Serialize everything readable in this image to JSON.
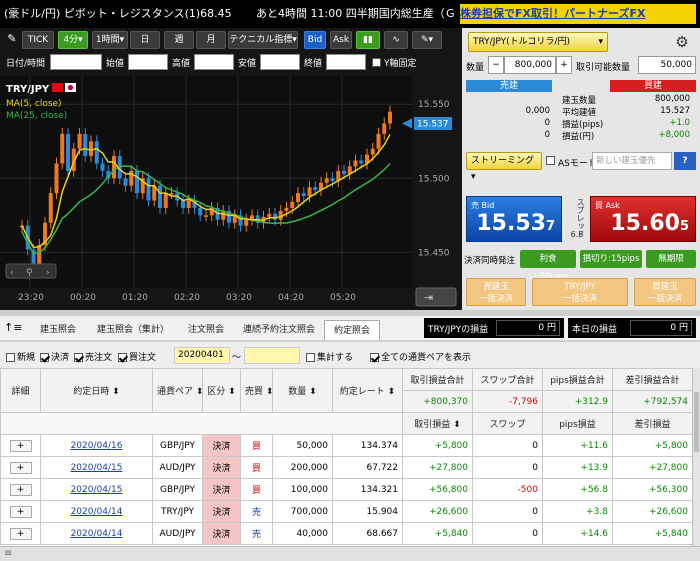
{
  "ticker": {
    "item1": "(豪ドル/円) ピボット・レジスタンス(1)68.45",
    "item2": "あと4時間 11:00 四半期国内総生産（ＧＤＰ）",
    "item3": "株券担保でFX取引！パートナーズFX"
  },
  "toolbar": {
    "tick": "TICK",
    "period": "4分",
    "hour": "1時間",
    "day": "日",
    "week": "週",
    "month": "月",
    "tech": "テクニカル指標",
    "bid": "Bid",
    "ask": "Ask"
  },
  "range": {
    "start": "日付/時間",
    "open": "始値",
    "high": "高値",
    "low": "安値",
    "close": "終値",
    "yfix": "Y軸固定"
  },
  "chart": {
    "symbol": "TRY/JPY",
    "ma5": "MA(5, close)",
    "ma25": "MA(25, close)",
    "current": "15.537",
    "yticks": [
      "15.550",
      "15.500",
      "15.450"
    ],
    "xticks": [
      "23:20",
      "00:20",
      "01:20",
      "02:20",
      "03:20",
      "04:20",
      "05:20"
    ],
    "colors": {
      "up": "#f07a1a",
      "down": "#2a8ad8",
      "ma5": "#e6d020",
      "ma25": "#3ab54a"
    }
  },
  "order": {
    "pair": "TRY/JPY(トルコリラ/円)",
    "qty_label": "数量",
    "qty": "800,000",
    "available_label": "取引可能数量",
    "available": "50,000",
    "sell_head": "売建",
    "buy_head": "買建",
    "rows": [
      {
        "label": "建玉数量",
        "sell": "",
        "buy": "800,000"
      },
      {
        "label": "平均建値",
        "sell": "0.000",
        "buy": "15.527"
      },
      {
        "label": "損益(pips)",
        "sell": "0",
        "buy": "+1.0"
      },
      {
        "label": "損益(円)",
        "sell": "0",
        "buy": "+8,000"
      }
    ],
    "streaming": "ストリーミング",
    "asmode": "ASモード",
    "newposition": "新しい建玉優先",
    "help": "?",
    "bid_label": "売 Bid",
    "bid_big": "15.53",
    "bid_small": "7",
    "spread_label": "スプレッド",
    "spread": "6.8",
    "ask_label": "買 Ask",
    "ask_big": "15.60",
    "ask_small": "5",
    "simul_label": "決済同時発注",
    "take_profit": "利食い:50pips",
    "stop_loss": "損切り:15pips",
    "unlimited": "無期限",
    "close_sell": "売建玉\n一括決済",
    "close_pair": "TRY/JPY\n一括決済",
    "close_buy": "買建玉\n一括決済"
  },
  "tabs": [
    "建玉照会",
    "建玉照会（集計）",
    "注文照会",
    "連続予約注文照会",
    "約定照会"
  ],
  "pl": {
    "pair_label": "TRY/JPYの損益",
    "pair_value": "0 円",
    "today_label": "本日の損益",
    "today_value": "0 円"
  },
  "filters": {
    "new": "新規",
    "settle": "決済",
    "sell": "売注文",
    "buy": "買注文",
    "date": "20200401",
    "tilde": "～",
    "aggregate": "集計する",
    "allpairs": "全ての通貨ペアを表示"
  },
  "table": {
    "headers": [
      "詳細",
      "約定日時",
      "通貨ペア",
      "区分",
      "売買",
      "数量",
      "約定レート",
      "取引損益合計",
      "スワップ合計",
      "pips損益合計",
      "差引損益合計"
    ],
    "sub_headers": [
      "取引損益",
      "スワップ",
      "pips損益",
      "差引損益"
    ],
    "totals": [
      "+800,370",
      "-7,796",
      "+312.9",
      "+792,574"
    ],
    "rows": [
      {
        "date": "2020/04/16",
        "pair": "GBP/JPY",
        "kind": "決済",
        "side": "買",
        "qty": "50,000",
        "rate": "134.374",
        "pl": "+5,800",
        "swap": "0",
        "pips": "+11.6",
        "net": "+5,800"
      },
      {
        "date": "2020/04/15",
        "pair": "AUD/JPY",
        "kind": "決済",
        "side": "買",
        "qty": "200,000",
        "rate": "67.722",
        "pl": "+27,800",
        "swap": "0",
        "pips": "+13.9",
        "net": "+27,800"
      },
      {
        "date": "2020/04/15",
        "pair": "GBP/JPY",
        "kind": "決済",
        "side": "買",
        "qty": "100,000",
        "rate": "134.321",
        "pl": "+56,800",
        "swap": "-500",
        "pips": "+56.8",
        "net": "+56,300"
      },
      {
        "date": "2020/04/14",
        "pair": "TRY/JPY",
        "kind": "決済",
        "side": "売",
        "qty": "700,000",
        "rate": "15.904",
        "pl": "+26,600",
        "swap": "0",
        "pips": "+3.8",
        "net": "+26,600"
      },
      {
        "date": "2020/04/14",
        "pair": "AUD/JPY",
        "kind": "決済",
        "side": "売",
        "qty": "40,000",
        "rate": "68.667",
        "pl": "+5,840",
        "swap": "0",
        "pips": "+14.6",
        "net": "+5,840"
      }
    ],
    "expand": "+"
  }
}
